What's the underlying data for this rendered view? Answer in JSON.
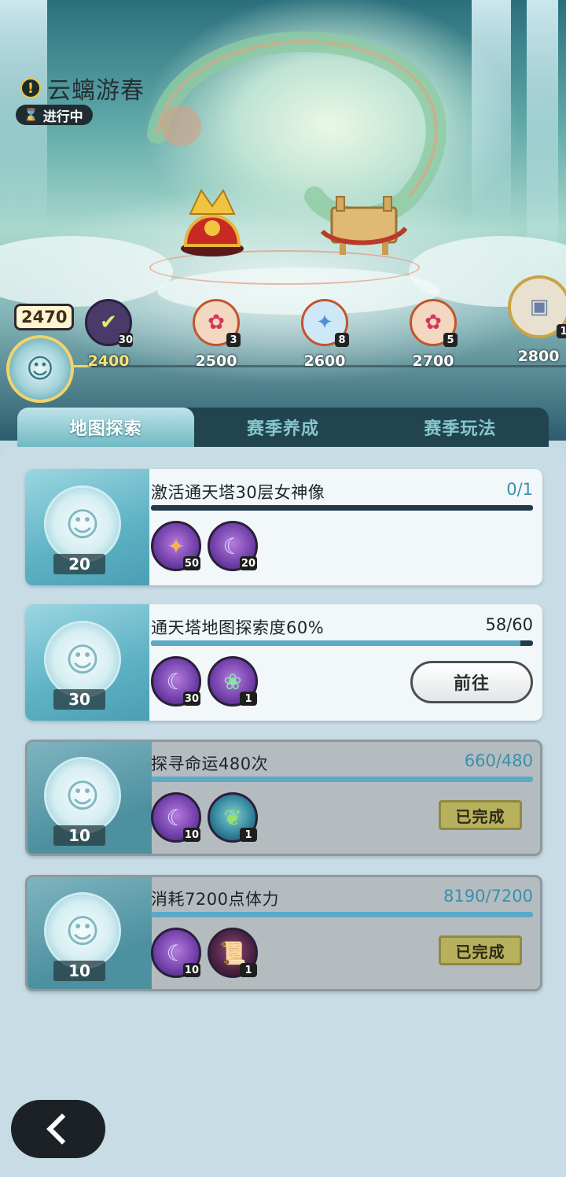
{
  "event": {
    "title": "云螭游春",
    "status": "进行中"
  },
  "progress": {
    "current": "2470",
    "milestones": [
      {
        "label": "2400",
        "count": "30",
        "icon": "claimed-check-icon",
        "claimed": true
      },
      {
        "label": "2500",
        "count": "3",
        "icon": "paw-token-icon"
      },
      {
        "label": "2600",
        "count": "8",
        "icon": "crystal-shard-icon"
      },
      {
        "label": "2700",
        "count": "5",
        "icon": "paw-token-icon"
      },
      {
        "label": "2800",
        "count": "1",
        "icon": "treasure-chest-icon"
      }
    ],
    "fill_fraction": 0.07
  },
  "tabs": [
    {
      "label": "地图探索",
      "active": true
    },
    {
      "label": "赛季养成",
      "active": false
    },
    {
      "label": "赛季玩法",
      "active": false
    }
  ],
  "tasks": [
    {
      "title": "激活通天塔30层女神像",
      "progress_text": "0/1",
      "fill_fraction": 0,
      "coin_reward": "20",
      "items": [
        {
          "icon": "star-crystal-icon",
          "count": "50"
        },
        {
          "icon": "moon-orb-icon",
          "count": "20"
        }
      ],
      "state": "locked"
    },
    {
      "title": "通天塔地图探索度60%",
      "progress_text": "58/60",
      "fill_fraction": 0.967,
      "coin_reward": "30",
      "items": [
        {
          "icon": "moon-orb-icon",
          "count": "30"
        },
        {
          "icon": "flower-pot-icon",
          "count": "1"
        }
      ],
      "state": "go",
      "button_label": "前往"
    },
    {
      "title": "探寻命运480次",
      "progress_text": "660/480",
      "fill_fraction": 1,
      "coin_reward": "10",
      "items": [
        {
          "icon": "moon-orb-icon",
          "count": "10"
        },
        {
          "icon": "herb-bowl-icon",
          "count": "1"
        }
      ],
      "state": "done",
      "button_label": "已完成"
    },
    {
      "title": "消耗7200点体力",
      "progress_text": "8190/7200",
      "fill_fraction": 1,
      "coin_reward": "10",
      "items": [
        {
          "icon": "moon-orb-icon",
          "count": "10"
        },
        {
          "icon": "scroll-icon",
          "count": "1"
        }
      ],
      "state": "done",
      "button_label": "已完成"
    }
  ],
  "colors": {
    "accent": "#5aa9c6",
    "done_badge": "#b7b05c",
    "panel": "#c8dce6"
  }
}
